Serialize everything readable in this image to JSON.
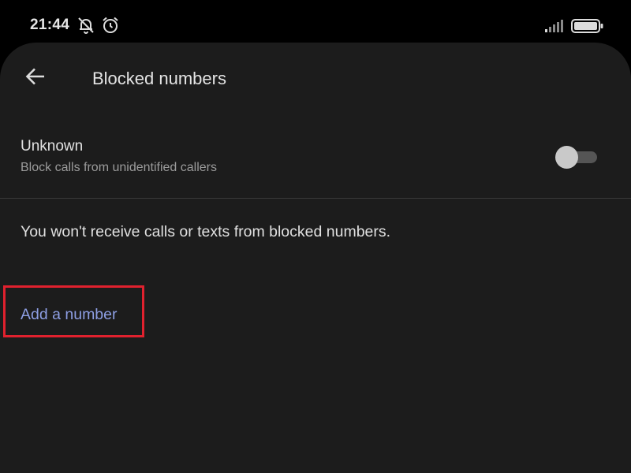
{
  "status_bar": {
    "time": "21:44",
    "icons": [
      "notifications-muted-icon",
      "alarm-icon",
      "signal-icon",
      "battery-icon"
    ]
  },
  "toolbar": {
    "back_icon": "arrow-left-icon",
    "title": "Blocked numbers"
  },
  "unknown_setting": {
    "title": "Unknown",
    "subtitle": "Block calls from unidentified callers",
    "enabled": false
  },
  "info": {
    "text": "You won't receive calls or texts from blocked numbers."
  },
  "actions": {
    "add_number_label": "Add a number"
  },
  "colors": {
    "background": "#1c1c1c",
    "status_bar": "#000000",
    "accent_link": "#8d9ee3",
    "highlight_border": "#e0212e",
    "toggle_thumb": "#c9c9c9",
    "toggle_track": "#555555"
  }
}
